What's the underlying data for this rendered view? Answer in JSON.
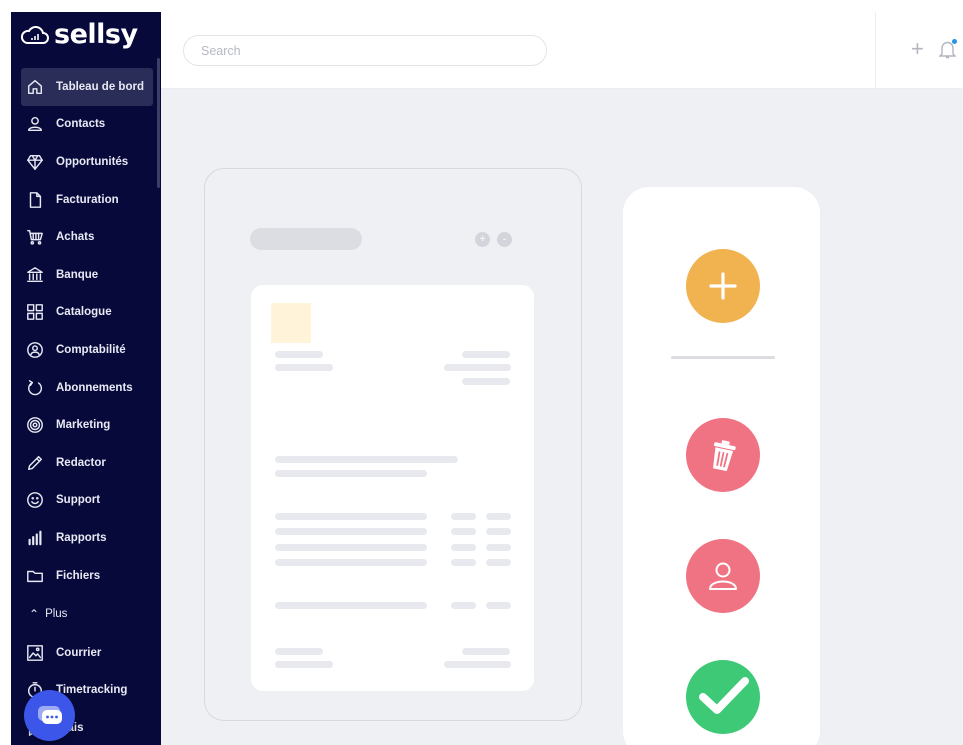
{
  "brand": {
    "name": "sellsy"
  },
  "search": {
    "placeholder": "Search"
  },
  "sidebar": {
    "items": [
      {
        "label": "Tableau de bord",
        "icon": "home-icon",
        "active": true
      },
      {
        "label": "Contacts",
        "icon": "user-icon"
      },
      {
        "label": "Opportunités",
        "icon": "diamond-icon"
      },
      {
        "label": "Facturation",
        "icon": "file-icon"
      },
      {
        "label": "Achats",
        "icon": "cart-icon"
      },
      {
        "label": "Banque",
        "icon": "bank-icon"
      },
      {
        "label": "Catalogue",
        "icon": "grid-icon"
      },
      {
        "label": "Comptabilité",
        "icon": "accounting-icon"
      },
      {
        "label": "Abonnements",
        "icon": "refresh-icon"
      },
      {
        "label": "Marketing",
        "icon": "target-icon"
      },
      {
        "label": "Redactor",
        "icon": "pen-icon"
      },
      {
        "label": "Support",
        "icon": "smiley-icon"
      },
      {
        "label": "Rapports",
        "icon": "bar-chart-icon"
      },
      {
        "label": "Fichiers",
        "icon": "folder-icon"
      }
    ],
    "more_label": "Plus",
    "extra_items": [
      {
        "label": "Courrier",
        "icon": "mail-image-icon"
      },
      {
        "label": "Timetracking",
        "icon": "stopwatch-icon"
      },
      {
        "label": "Frais",
        "icon": "receipt-icon"
      }
    ]
  },
  "colors": {
    "sidebar_bg": "#07093a",
    "active_item_bg": "#2a2d57",
    "add": "#f1b350",
    "delete": "#f07383",
    "user": "#f07383",
    "validate": "#3ec977",
    "chat": "#3b56e8"
  },
  "actions": [
    {
      "name": "add",
      "icon": "plus-icon"
    },
    {
      "name": "delete",
      "icon": "trash-icon"
    },
    {
      "name": "user",
      "icon": "user-icon"
    },
    {
      "name": "validate",
      "icon": "check-icon"
    }
  ]
}
